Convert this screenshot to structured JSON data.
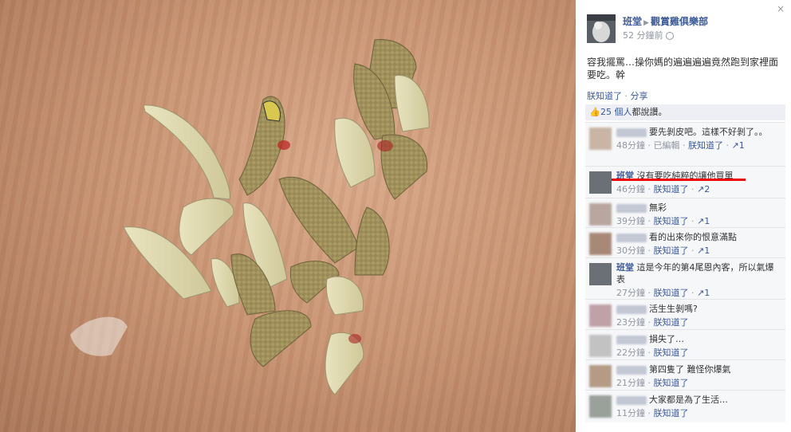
{
  "post": {
    "author": "班堂",
    "group": "觀賞雞俱樂部",
    "time": "52 分鐘前",
    "caption": "容我擺罵…操你媽的遍遍遍遍竟然跑到家裡面要吃。幹",
    "actions": {
      "like": "朕知道了",
      "share": "分享"
    },
    "likes_prefix": "25 個人",
    "likes_suffix": "都說讚。"
  },
  "comments": [
    {
      "name": "",
      "text": "要先剝皮吧。這樣不好剝了。。",
      "time": "48分鐘",
      "edited": "已編輯",
      "like": "朕知道了",
      "like_count": "1"
    },
    {
      "name": "班堂",
      "text": "沒有要吃純粹的讓他買單",
      "time": "46分鐘",
      "edited": "",
      "like": "朕知道了",
      "like_count": "2"
    },
    {
      "name": "",
      "text": "無彩",
      "time": "39分鐘",
      "edited": "",
      "like": "朕知道了",
      "like_count": "1"
    },
    {
      "name": "",
      "text": "看的出來你的恨意滿點",
      "time": "30分鐘",
      "edited": "",
      "like": "朕知道了",
      "like_count": "1"
    },
    {
      "name": "班堂",
      "text": "這是今年的第4尾恩內客，所以氣爆表",
      "time": "27分鐘",
      "edited": "",
      "like": "朕知道了",
      "like_count": "1"
    },
    {
      "name": "",
      "text": "活生生剝嗎?",
      "time": "23分鐘",
      "edited": "",
      "like": "朕知道了",
      "like_count": ""
    },
    {
      "name": "",
      "text": "損失了…",
      "time": "22分鐘",
      "edited": "",
      "like": "朕知道了",
      "like_count": ""
    },
    {
      "name": "",
      "text": "第四隻了 難怪你爆氣",
      "time": "21分鐘",
      "edited": "",
      "like": "朕知道了",
      "like_count": ""
    },
    {
      "name": "",
      "text": "大家都是為了生活…",
      "time": "11分鐘",
      "edited": "",
      "like": "朕知道了",
      "like_count": ""
    }
  ],
  "ui": {
    "close_glyph": "×",
    "meta_sep": "·",
    "like_glyph": "↗",
    "thumb_glyph": "👍"
  },
  "colors": {
    "link": "#3b5998",
    "muted": "#9197a3",
    "highlight": "#e00000",
    "panel_bg": "#ffffff",
    "comment_bg": "#f6f7f9"
  },
  "icons": [
    "close-icon",
    "globe-icon",
    "thumbs-up-icon",
    "like-arrow-icon"
  ]
}
